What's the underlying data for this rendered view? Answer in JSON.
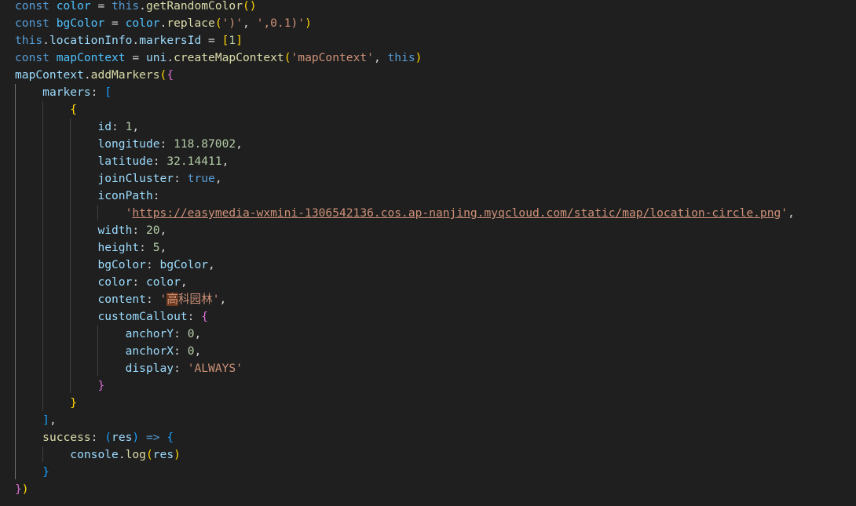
{
  "code_lines": [
    [
      [
        "const ",
        "kw"
      ],
      [
        "color",
        "var"
      ],
      [
        " = ",
        "punc"
      ],
      [
        "this",
        "kw"
      ],
      [
        ".",
        "punc"
      ],
      [
        "getRandomColor",
        "fn"
      ],
      [
        "()",
        "b1"
      ]
    ],
    [
      [
        "const ",
        "kw"
      ],
      [
        "bgColor",
        "var"
      ],
      [
        " = ",
        "punc"
      ],
      [
        "color",
        "var"
      ],
      [
        ".",
        "punc"
      ],
      [
        "replace",
        "fn"
      ],
      [
        "(",
        "b1"
      ],
      [
        "')'",
        "str"
      ],
      [
        ", ",
        "punc"
      ],
      [
        "',0.1)'",
        "str"
      ],
      [
        ")",
        "b1"
      ]
    ],
    [
      [
        "this",
        "kw"
      ],
      [
        ".",
        "punc"
      ],
      [
        "locationInfo",
        "prop"
      ],
      [
        ".",
        "punc"
      ],
      [
        "markersId",
        "prop"
      ],
      [
        " = ",
        "punc"
      ],
      [
        "[",
        "b1"
      ],
      [
        "1",
        "num"
      ],
      [
        "]",
        "b1"
      ]
    ],
    [
      [
        "const ",
        "kw"
      ],
      [
        "mapContext",
        "var"
      ],
      [
        " = ",
        "punc"
      ],
      [
        "uni",
        "prop"
      ],
      [
        ".",
        "punc"
      ],
      [
        "createMapContext",
        "fn"
      ],
      [
        "(",
        "b1"
      ],
      [
        "'mapContext'",
        "str"
      ],
      [
        ", ",
        "punc"
      ],
      [
        "this",
        "kw"
      ],
      [
        ")",
        "b1"
      ]
    ],
    [
      [
        "mapContext",
        "prop"
      ],
      [
        ".",
        "punc"
      ],
      [
        "addMarkers",
        "fn"
      ],
      [
        "(",
        "b1"
      ],
      [
        "{",
        "b2"
      ]
    ],
    [
      [
        "    ",
        "punc"
      ],
      [
        "markers",
        "prop"
      ],
      [
        ": ",
        "punc"
      ],
      [
        "[",
        "b3"
      ]
    ],
    [
      [
        "        ",
        "punc"
      ],
      [
        "{",
        "b1"
      ]
    ],
    [
      [
        "            ",
        "punc"
      ],
      [
        "id",
        "prop"
      ],
      [
        ": ",
        "punc"
      ],
      [
        "1",
        "num"
      ],
      [
        ",",
        "punc"
      ]
    ],
    [
      [
        "            ",
        "punc"
      ],
      [
        "longitude",
        "prop"
      ],
      [
        ": ",
        "punc"
      ],
      [
        "118.87002",
        "num"
      ],
      [
        ",",
        "punc"
      ]
    ],
    [
      [
        "            ",
        "punc"
      ],
      [
        "latitude",
        "prop"
      ],
      [
        ": ",
        "punc"
      ],
      [
        "32.14411",
        "num"
      ],
      [
        ",",
        "punc"
      ]
    ],
    [
      [
        "            ",
        "punc"
      ],
      [
        "joinCluster",
        "prop"
      ],
      [
        ": ",
        "punc"
      ],
      [
        "true",
        "bool"
      ],
      [
        ",",
        "punc"
      ]
    ],
    [
      [
        "            ",
        "punc"
      ],
      [
        "iconPath",
        "prop"
      ],
      [
        ":",
        "punc"
      ]
    ],
    [
      [
        "                ",
        "punc"
      ],
      [
        "'",
        "str"
      ],
      [
        "https://easymedia-wxmini-1306542136.cos.ap-nanjing.myqcloud.com/static/map/location-circle.png",
        "str-link"
      ],
      [
        "'",
        "str"
      ],
      [
        ",",
        "punc"
      ]
    ],
    [
      [
        "            ",
        "punc"
      ],
      [
        "width",
        "prop"
      ],
      [
        ": ",
        "punc"
      ],
      [
        "20",
        "num"
      ],
      [
        ",",
        "punc"
      ]
    ],
    [
      [
        "            ",
        "punc"
      ],
      [
        "height",
        "prop"
      ],
      [
        ": ",
        "punc"
      ],
      [
        "5",
        "num"
      ],
      [
        ",",
        "punc"
      ]
    ],
    [
      [
        "            ",
        "punc"
      ],
      [
        "bgColor",
        "prop"
      ],
      [
        ": ",
        "punc"
      ],
      [
        "bgColor",
        "prop"
      ],
      [
        ",",
        "punc"
      ]
    ],
    [
      [
        "            ",
        "punc"
      ],
      [
        "color",
        "prop"
      ],
      [
        ": ",
        "punc"
      ],
      [
        "color",
        "prop"
      ],
      [
        ",",
        "punc"
      ]
    ],
    [
      [
        "            ",
        "punc"
      ],
      [
        "content",
        "prop"
      ],
      [
        ": ",
        "punc"
      ],
      [
        "'",
        "str"
      ],
      [
        "高",
        "str-hl"
      ],
      [
        "科园林'",
        "str"
      ],
      [
        ",",
        "punc"
      ]
    ],
    [
      [
        "            ",
        "punc"
      ],
      [
        "customCallout",
        "prop"
      ],
      [
        ": ",
        "punc"
      ],
      [
        "{",
        "b2"
      ]
    ],
    [
      [
        "                ",
        "punc"
      ],
      [
        "anchorY",
        "prop"
      ],
      [
        ": ",
        "punc"
      ],
      [
        "0",
        "num"
      ],
      [
        ",",
        "punc"
      ]
    ],
    [
      [
        "                ",
        "punc"
      ],
      [
        "anchorX",
        "prop"
      ],
      [
        ": ",
        "punc"
      ],
      [
        "0",
        "num"
      ],
      [
        ",",
        "punc"
      ]
    ],
    [
      [
        "                ",
        "punc"
      ],
      [
        "display",
        "prop"
      ],
      [
        ": ",
        "punc"
      ],
      [
        "'ALWAYS'",
        "str"
      ]
    ],
    [
      [
        "            ",
        "punc"
      ],
      [
        "}",
        "b2"
      ]
    ],
    [
      [
        "        ",
        "punc"
      ],
      [
        "}",
        "b1"
      ]
    ],
    [
      [
        "    ",
        "punc"
      ],
      [
        "]",
        "b3"
      ],
      [
        ",",
        "punc"
      ]
    ],
    [
      [
        "    ",
        "punc"
      ],
      [
        "success",
        "fn"
      ],
      [
        ": ",
        "punc"
      ],
      [
        "(",
        "b3"
      ],
      [
        "res",
        "prop"
      ],
      [
        ")",
        "b3"
      ],
      [
        " => ",
        "kw"
      ],
      [
        "{",
        "b3"
      ]
    ],
    [
      [
        "        ",
        "punc"
      ],
      [
        "console",
        "prop"
      ],
      [
        ".",
        "punc"
      ],
      [
        "log",
        "fn"
      ],
      [
        "(",
        "b1"
      ],
      [
        "res",
        "prop"
      ],
      [
        ")",
        "b1"
      ]
    ],
    [
      [
        "    ",
        "punc"
      ],
      [
        "}",
        "b3"
      ]
    ],
    [
      [
        "}",
        "b2"
      ],
      [
        ")",
        "b1"
      ]
    ]
  ],
  "theme": {
    "background": "#1f1f1f",
    "keyword": "#569cd6",
    "variable": "#4fc1ff",
    "function": "#dcdcaa",
    "property": "#9cdcfe",
    "string": "#ce9178",
    "number": "#b5cea8",
    "bracket_gold": "#ffd700",
    "bracket_orchid": "#da70d6",
    "bracket_blue": "#179fff"
  }
}
